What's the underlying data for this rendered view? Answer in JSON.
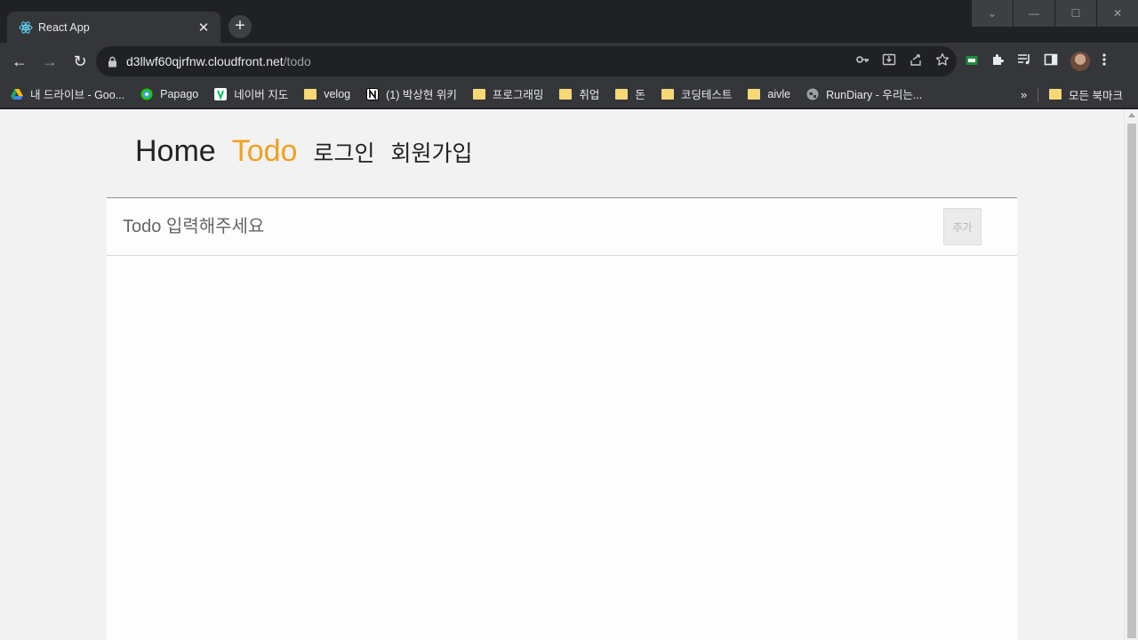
{
  "browser": {
    "tab": {
      "title": "React App",
      "close_glyph": "✕"
    },
    "new_tab_glyph": "+",
    "window_controls": [
      "⌄",
      "—",
      "☐",
      "✕"
    ],
    "nav": {
      "back": "←",
      "forward": "→",
      "reload": "↻"
    },
    "address": {
      "host": "d3llwf60qjrfnw.cloudfront.net",
      "path": "/todo"
    },
    "bookmarks": [
      {
        "label": "내 드라이브 - Goo...",
        "icon": "google-drive-icon"
      },
      {
        "label": "Papago",
        "icon": "papago-icon"
      },
      {
        "label": "네이버 지도",
        "icon": "naver-map-icon"
      },
      {
        "label": "velog",
        "icon": "folder-icon"
      },
      {
        "label": "(1) 박상현 위키",
        "icon": "notion-icon"
      },
      {
        "label": "프로그래밍",
        "icon": "folder-icon"
      },
      {
        "label": "취업",
        "icon": "folder-icon"
      },
      {
        "label": "돈",
        "icon": "folder-icon"
      },
      {
        "label": "코딩테스트",
        "icon": "folder-icon"
      },
      {
        "label": "aivle",
        "icon": "folder-icon"
      },
      {
        "label": "RunDiary - 우리는...",
        "icon": "globe-icon"
      }
    ],
    "bookmarks_more": "»",
    "all_bookmarks": "모든 북마크"
  },
  "page": {
    "nav": {
      "home": "Home",
      "todo": "Todo",
      "login": "로그인",
      "signup": "회원가입"
    },
    "todo_input": {
      "placeholder": "Todo 입력해주세요",
      "value": ""
    },
    "add_button": "추가"
  },
  "colors": {
    "active_nav": "#f0a020",
    "text": "#222222"
  }
}
